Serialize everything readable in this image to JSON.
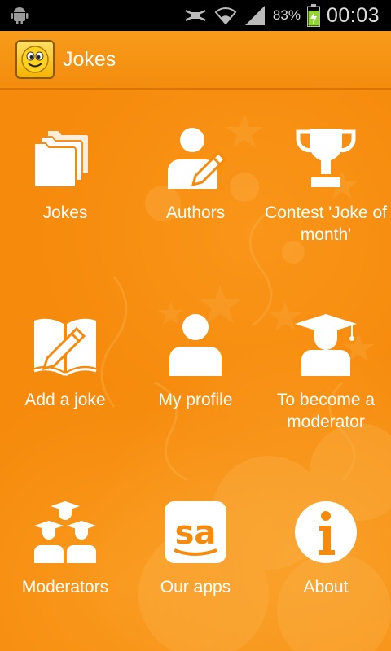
{
  "status_bar": {
    "battery": "83%",
    "time": "00:03",
    "icons": [
      "android-icon",
      "mute-icon",
      "wifi-icon",
      "signal-icon",
      "battery-icon"
    ]
  },
  "action_bar": {
    "title": "Jokes",
    "logo_icon": "smiley-icon"
  },
  "menu": {
    "items": [
      {
        "label": "Jokes",
        "icon": "folders-icon"
      },
      {
        "label": "Authors",
        "icon": "author-icon"
      },
      {
        "label": "Contest 'Joke of month'",
        "icon": "trophy-icon"
      },
      {
        "label": "Add a joke",
        "icon": "book-pencil-icon"
      },
      {
        "label": "My profile",
        "icon": "person-icon"
      },
      {
        "label": "To become a moderator",
        "icon": "graduate-icon"
      },
      {
        "label": "Moderators",
        "icon": "graduates-icon"
      },
      {
        "label": "Our apps",
        "icon": "sa-icon"
      },
      {
        "label": "About",
        "icon": "info-icon"
      }
    ]
  },
  "colors": {
    "background": "#f68a0c",
    "action_bar": "#f79b1a",
    "text": "#ffffff",
    "status_bar": "#000000"
  }
}
